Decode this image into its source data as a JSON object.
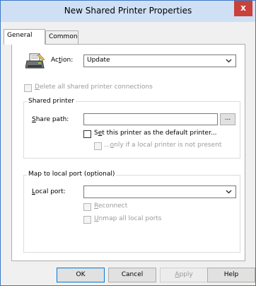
{
  "window": {
    "title": "New Shared Printer Properties",
    "close_glyph": "x"
  },
  "tabs": [
    {
      "label": "General",
      "active": true
    },
    {
      "label": "Common",
      "active": false
    }
  ],
  "action": {
    "label_prefix": "Ac",
    "label_u": "t",
    "label_rest": "ion:",
    "value": "Update",
    "icon": "printer-icon"
  },
  "delete_all": {
    "label_u": "D",
    "label_rest": "elete all shared printer connections",
    "checked": false,
    "enabled": false
  },
  "shared_printer": {
    "legend": "Shared printer",
    "share_path_label_u": "S",
    "share_path_label_rest": "hare path:",
    "share_path_value": "",
    "browse_label": "...",
    "set_default": {
      "label_prefix": "S",
      "label_u": "e",
      "label_rest": "t this printer as the default printer...",
      "checked": false
    },
    "only_if": {
      "label_prefix": "...",
      "label_u": "o",
      "label_rest": "nly if a local printer is not present",
      "checked": false,
      "enabled": false
    }
  },
  "map_local_port": {
    "legend": "Map to local port (optional)",
    "local_port_label_u": "L",
    "local_port_label_rest": "ocal port:",
    "local_port_value": "",
    "reconnect": {
      "label_u": "R",
      "label_rest": "econnect",
      "checked": false,
      "enabled": false
    },
    "unmap": {
      "label_u": "U",
      "label_rest": "nmap all local ports",
      "checked": false,
      "enabled": false
    }
  },
  "buttons": {
    "ok": "OK",
    "cancel": "Cancel",
    "apply_u": "A",
    "apply_rest": "pply",
    "help": "Help"
  },
  "colors": {
    "titlebar": "#cfe0f5",
    "close_button": "#c9413a",
    "default_button_border": "#0078d7"
  }
}
